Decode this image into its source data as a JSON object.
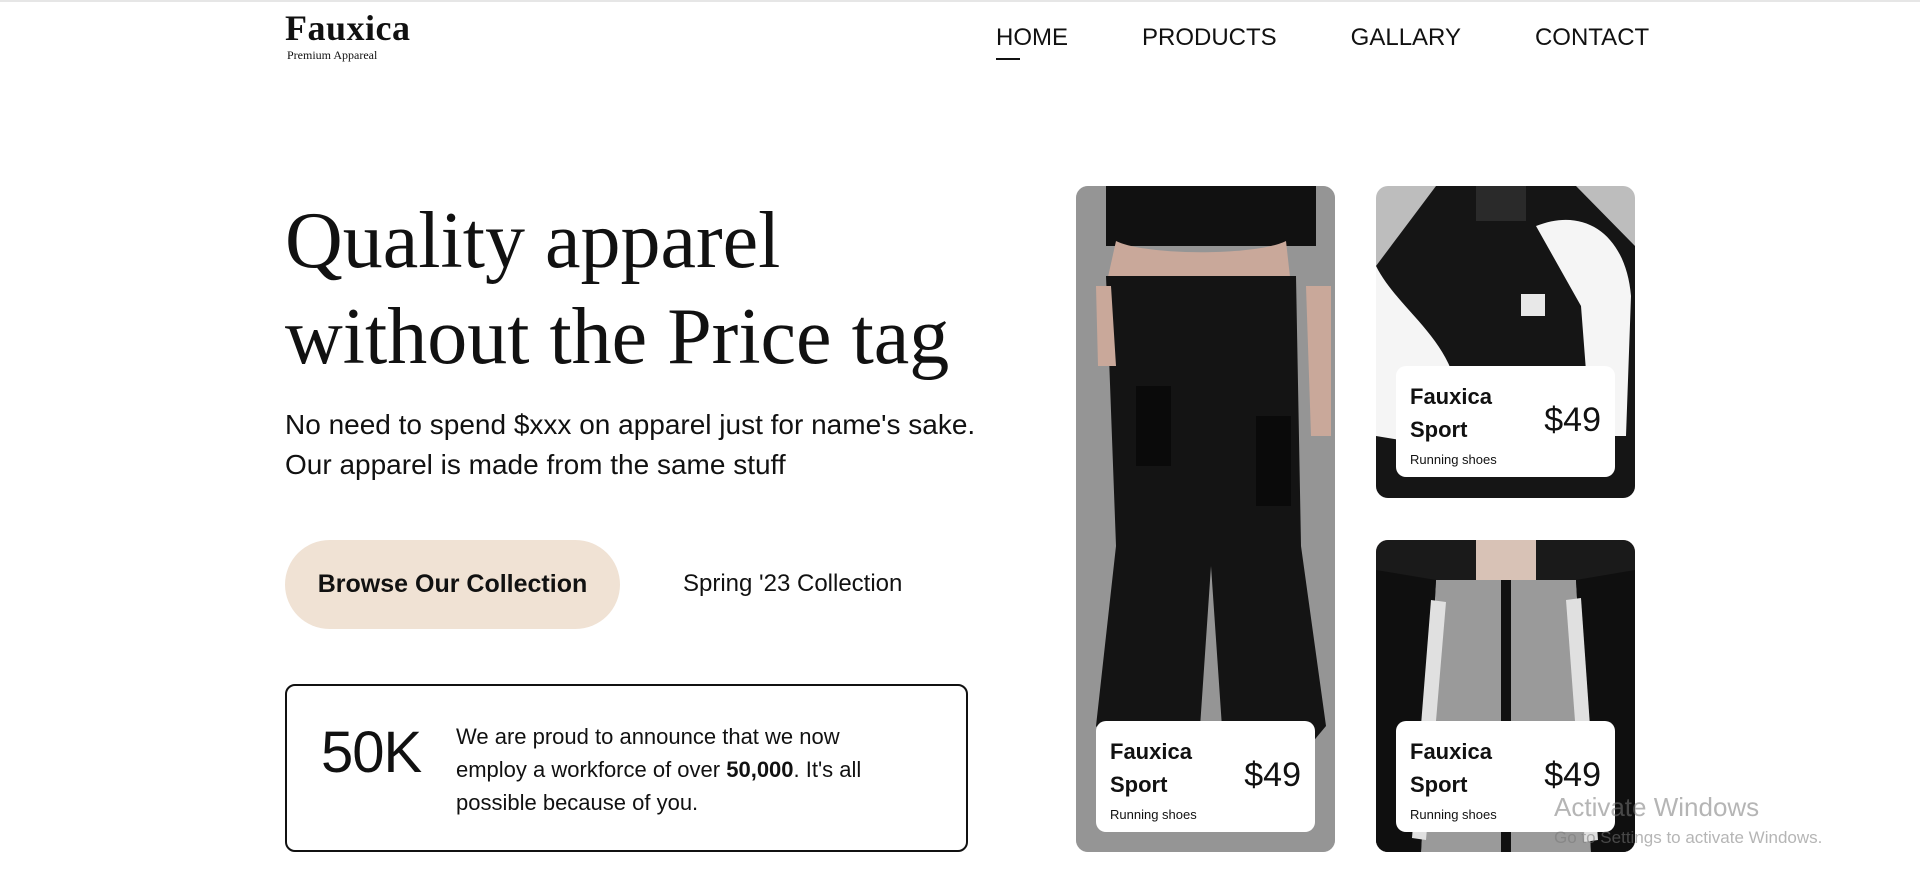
{
  "brand": {
    "name": "Fauxica",
    "tagline": "Premium Appareal"
  },
  "nav": [
    {
      "label": "HOME",
      "active": true
    },
    {
      "label": "PRODUCTS",
      "active": false
    },
    {
      "label": "GALLARY",
      "active": false
    },
    {
      "label": "CONTACT",
      "active": false
    }
  ],
  "hero": {
    "title": "Quality apparel without the Price tag",
    "subtitle": "No need to spend $xxx on apparel just for name's sake. Our apparel is made from the same stuff",
    "cta_label": "Browse Our Collection",
    "collection_label": "Spring '23 Collection"
  },
  "stat": {
    "number": "50K",
    "text_before": "We are proud to announce that we now employ a workforce of over ",
    "text_bold": "50,000",
    "text_after": ". It's all possible because of you."
  },
  "products": [
    {
      "name": "Fauxica Sport",
      "price": "$49",
      "desc": "Running shoes",
      "image": "black-cargo-pants-photo"
    },
    {
      "name": "Fauxica Sport",
      "price": "$49",
      "desc": "Running shoes",
      "image": "black-white-jacket-photo"
    },
    {
      "name": "Fauxica Sport",
      "price": "$49",
      "desc": "Running shoes",
      "image": "grey-black-jacket-photo"
    }
  ],
  "watermark": {
    "title": "Activate Windows",
    "subtitle": "Go to Settings to activate Windows."
  },
  "colors": {
    "cta_background": "#f0e2d4",
    "text": "#111111",
    "background": "#ffffff"
  }
}
